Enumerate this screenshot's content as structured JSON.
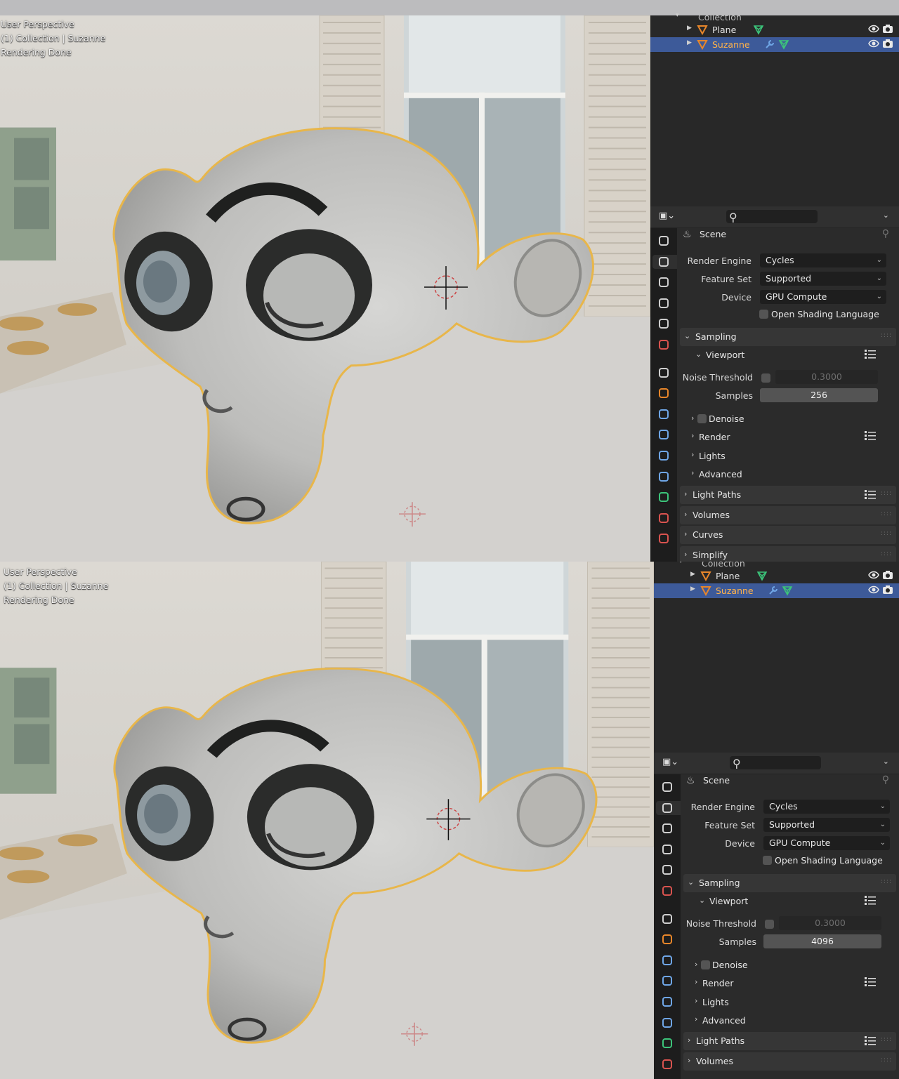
{
  "screens": [
    {
      "overlay": [
        "User Perspective",
        "(1) Collection | Suzanne",
        "Rendering Done"
      ],
      "outliner": {
        "collection": "Collection",
        "items": [
          {
            "name": "Plane",
            "selected": false
          },
          {
            "name": "Suzanne",
            "selected": true
          }
        ]
      },
      "properties": {
        "scene_label": "Scene",
        "render_engine": {
          "label": "Render Engine",
          "value": "Cycles"
        },
        "feature_set": {
          "label": "Feature Set",
          "value": "Supported"
        },
        "device": {
          "label": "Device",
          "value": "GPU Compute"
        },
        "osl": {
          "label": "Open Shading Language",
          "checked": false
        },
        "sampling": {
          "title": "Sampling",
          "viewport": {
            "title": "Viewport",
            "noise_threshold": {
              "label": "Noise Threshold",
              "value": "0.3000",
              "enabled": false
            },
            "samples": {
              "label": "Samples",
              "value": "256"
            },
            "denoise": "Denoise"
          },
          "render": "Render",
          "lights": "Lights",
          "advanced": "Advanced"
        },
        "panels": [
          "Light Paths",
          "Volumes",
          "Curves",
          "Simplify"
        ]
      }
    },
    {
      "overlay": [
        "User Perspective",
        "(1) Collection | Suzanne",
        "Rendering Done"
      ],
      "outliner": {
        "collection": "Collection",
        "items": [
          {
            "name": "Plane",
            "selected": false
          },
          {
            "name": "Suzanne",
            "selected": true
          }
        ]
      },
      "properties": {
        "scene_label": "Scene",
        "render_engine": {
          "label": "Render Engine",
          "value": "Cycles"
        },
        "feature_set": {
          "label": "Feature Set",
          "value": "Supported"
        },
        "device": {
          "label": "Device",
          "value": "GPU Compute"
        },
        "osl": {
          "label": "Open Shading Language",
          "checked": false
        },
        "sampling": {
          "title": "Sampling",
          "viewport": {
            "title": "Viewport",
            "noise_threshold": {
              "label": "Noise Threshold",
              "value": "0.3000",
              "enabled": false
            },
            "samples": {
              "label": "Samples",
              "value": "4096"
            },
            "denoise": "Denoise"
          },
          "render": "Render",
          "lights": "Lights",
          "advanced": "Advanced"
        },
        "panels": [
          "Light Paths",
          "Volumes"
        ]
      }
    }
  ],
  "colors": {
    "selection": "#3d5a99",
    "selected_text": "#ffb24a",
    "object_orange": "#e8862a",
    "mesh_green": "#3cc47a",
    "panel_bg": "#303030",
    "field_bg": "#1e1e1e",
    "samples_field": "#545454"
  }
}
